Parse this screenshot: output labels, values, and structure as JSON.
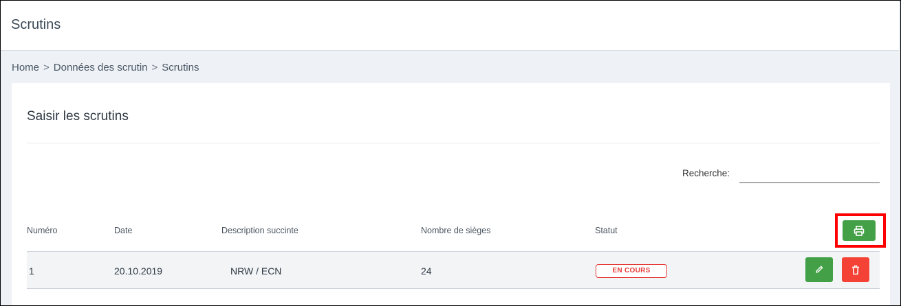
{
  "page": {
    "title": "Scrutins"
  },
  "breadcrumb": {
    "items": [
      "Home",
      "Données des scrutin",
      "Scrutins"
    ],
    "separator": ">"
  },
  "card": {
    "title": "Saisir les scrutins"
  },
  "search": {
    "label": "Recherche:",
    "value": "",
    "placeholder": ""
  },
  "table": {
    "columns": [
      "Numéro",
      "Date",
      "Description succinte",
      "Nombre de sièges",
      "Statut"
    ],
    "rows": [
      {
        "numero": "1",
        "date": "20.10.2019",
        "description": "NRW / ECN",
        "sieges": "24",
        "statut": "EN COURS"
      }
    ]
  },
  "actions": {
    "print_icon": "printer-icon",
    "edit_icon": "pencil-icon",
    "delete_icon": "trash-icon"
  },
  "colors": {
    "green": "#43a047",
    "red": "#f44336",
    "status_red": "#e53935",
    "highlight": "#ff0000"
  }
}
